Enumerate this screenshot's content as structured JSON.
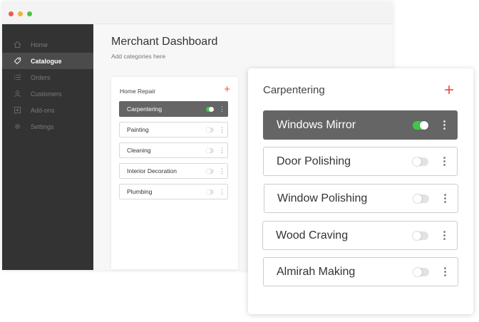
{
  "window": {
    "controls": [
      "close",
      "minimize",
      "maximize"
    ]
  },
  "sidebar": {
    "items": [
      {
        "label": "Home",
        "icon": "home-icon"
      },
      {
        "label": "Catalogue",
        "icon": "tag-icon",
        "active": true
      },
      {
        "label": "Orders",
        "icon": "list-icon"
      },
      {
        "label": "Customers",
        "icon": "user-icon"
      },
      {
        "label": "Add-ons",
        "icon": "plus-square-icon"
      },
      {
        "label": "Settings",
        "icon": "gear-icon"
      }
    ]
  },
  "header": {
    "title": "Merchant Dashboard",
    "subtitle": "Add categories here"
  },
  "category_panel": {
    "title": "Home Repair",
    "add_icon": "plus-icon",
    "items": [
      {
        "label": "Carpentering",
        "enabled": true,
        "active": true
      },
      {
        "label": "Painting",
        "enabled": false
      },
      {
        "label": "Cleaning",
        "enabled": false
      },
      {
        "label": "Interior Decoration",
        "enabled": false
      },
      {
        "label": "Plumbing",
        "enabled": false
      }
    ]
  },
  "subcategory_card": {
    "title": "Carpentering",
    "add_icon": "plus-icon",
    "items": [
      {
        "label": "Windows Mirror",
        "enabled": true,
        "active": true
      },
      {
        "label": "Door Polishing",
        "enabled": false
      },
      {
        "label": "Window Polishing",
        "enabled": false
      },
      {
        "label": "Wood Craving",
        "enabled": false
      },
      {
        "label": "Almirah Making",
        "enabled": false
      }
    ]
  },
  "colors": {
    "sidebar_bg": "#333333",
    "active_item_bg": "#656565",
    "accent": "#e8553d",
    "toggle_on": "#3ec946"
  }
}
